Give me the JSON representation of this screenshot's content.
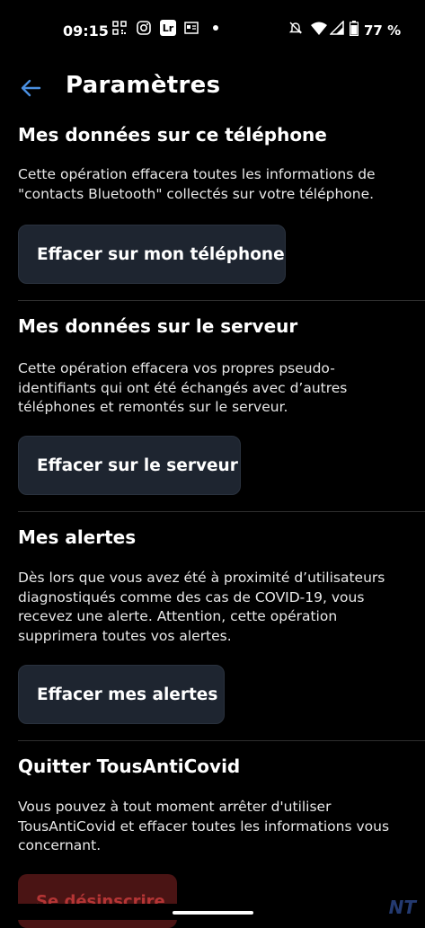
{
  "status_bar": {
    "time": "09:15",
    "battery": "77 %",
    "icons": [
      "qr-icon",
      "instagram-icon",
      "lightroom-icon",
      "news-icon",
      "notification-dot",
      "mute-icon",
      "wifi-icon",
      "signal-icon",
      "battery-icon"
    ],
    "lightroom_label": "Lr"
  },
  "app_bar": {
    "title": "Paramètres",
    "back_icon": "arrow-left-icon",
    "accent": "#4a8fe0"
  },
  "sections": [
    {
      "heading": "Mes données sur ce téléphone",
      "description": "Cette opération effacera toutes les informations de \"contacts Bluetooth\" collectés sur votre téléphone.",
      "button": "Effacer sur mon téléphone"
    },
    {
      "heading": "Mes données sur le serveur",
      "description": "Cette opération effacera vos propres pseudo-identifiants qui ont été échangés avec d’autres téléphones et remontés sur le serveur.",
      "button": "Effacer sur le serveur"
    },
    {
      "heading": "Mes alertes",
      "description": "Dès lors que vous avez été à proximité d’utilisateurs diagnostiqués comme des cas de COVID-19, vous recevez une alerte. Attention, cette opération supprimera toutes vos alertes.",
      "button": "Effacer mes alertes"
    },
    {
      "heading": "Quitter TousAntiCovid",
      "description": "Vous pouvez à tout moment arrêter d'utiliser TousAntiCovid et effacer toutes les informations vous concernant.",
      "button": "Se désinscrire"
    }
  ],
  "colors": {
    "background": "#000000",
    "button_bg": "#1e2530",
    "danger_bg": "#4a1414",
    "danger_text": "#b53535"
  },
  "watermark": "NT"
}
